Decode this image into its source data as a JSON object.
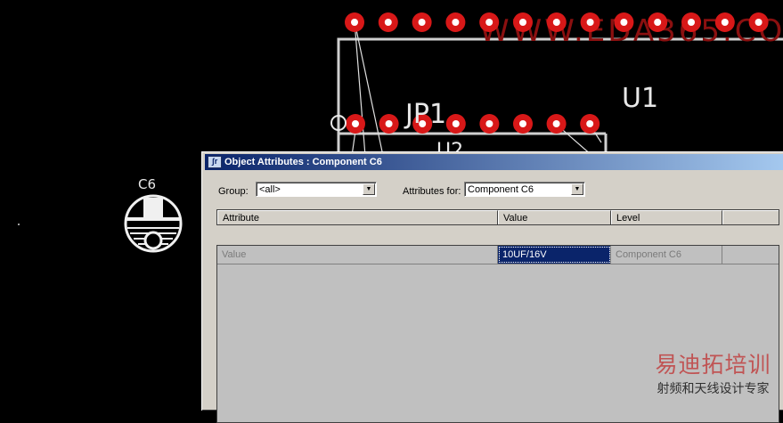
{
  "pcb": {
    "component_label": "C6",
    "connector_label": "JP1",
    "ic_label": "U1",
    "partial_label": "U2",
    "watermark_url": "WWW.EDA365.COM",
    "colors": {
      "pad": "#d81818",
      "silk": "#e8e8e8",
      "background": "#000000"
    }
  },
  "dialog": {
    "title": "Object Attributes : Component C6",
    "group_label": "Group:",
    "group_value": "<all>",
    "attributes_for_label": "Attributes for:",
    "attributes_for_value": "Component C6",
    "columns": [
      "Attribute",
      "Value",
      "Level",
      ""
    ],
    "rows": [
      {
        "attribute": "Value",
        "value": "10UF/16V",
        "level": "Component C6",
        "extra": ""
      }
    ]
  },
  "brand": {
    "title": "易迪拓培训",
    "subtitle": "射频和天线设计专家",
    "colors": {
      "title": "#c03030",
      "subtitle": "#303030"
    }
  }
}
